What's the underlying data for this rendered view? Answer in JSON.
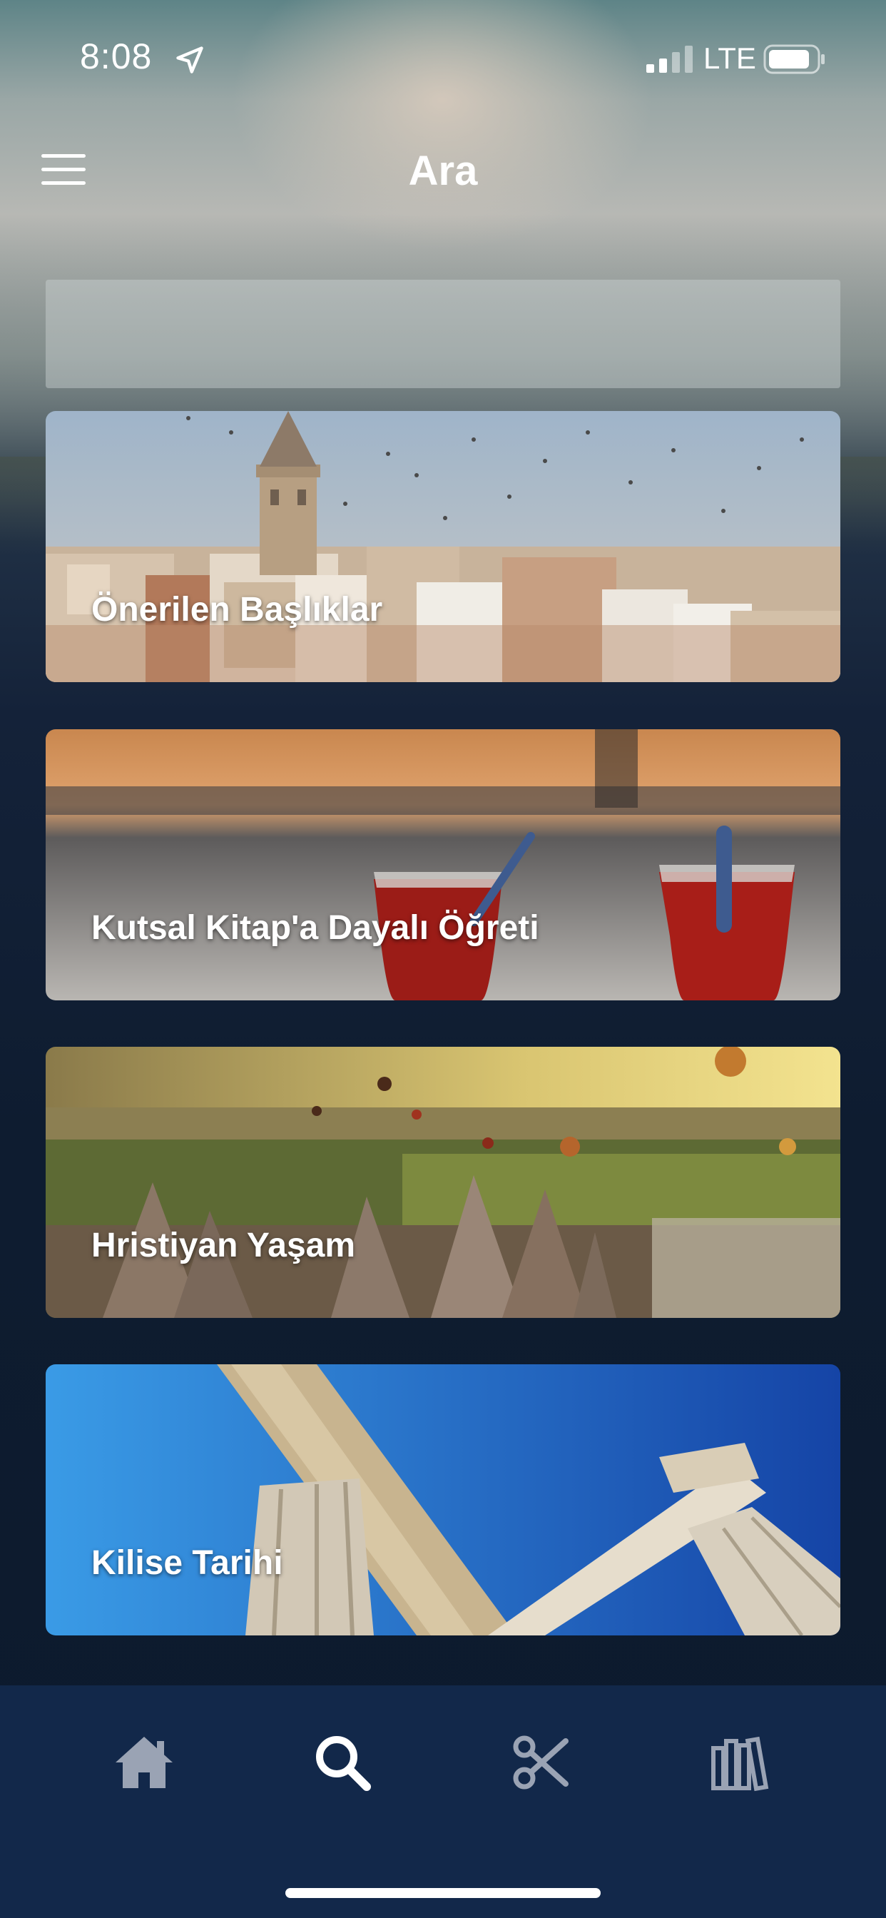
{
  "status_bar": {
    "time": "8:08",
    "network": "LTE",
    "icons": [
      "location-arrow-icon",
      "signal-bars-icon",
      "battery-icon"
    ]
  },
  "header": {
    "title": "Ara",
    "menu_icon": "hamburger-menu-icon"
  },
  "search": {
    "value": "",
    "placeholder": ""
  },
  "categories": [
    {
      "label": "Önerilen Başlıklar",
      "image": "istanbul-galata-tower"
    },
    {
      "label": "Kutsal Kitap'a Dayalı Öğreti",
      "image": "turkish-tea-glasses"
    },
    {
      "label": "Hristiyan Yaşam",
      "image": "cappadocia-balloons"
    },
    {
      "label": "Kilise Tarihi",
      "image": "ancient-columns"
    }
  ],
  "tab_bar": {
    "tabs": [
      {
        "name": "home",
        "icon": "home-icon",
        "active": false
      },
      {
        "name": "search",
        "icon": "search-icon",
        "active": true
      },
      {
        "name": "clips",
        "icon": "scissors-icon",
        "active": false
      },
      {
        "name": "library",
        "icon": "library-icon",
        "active": false
      }
    ],
    "colors": {
      "active": "#ffffff",
      "inactive": "#9aa3b4",
      "background": "#12284a"
    }
  }
}
